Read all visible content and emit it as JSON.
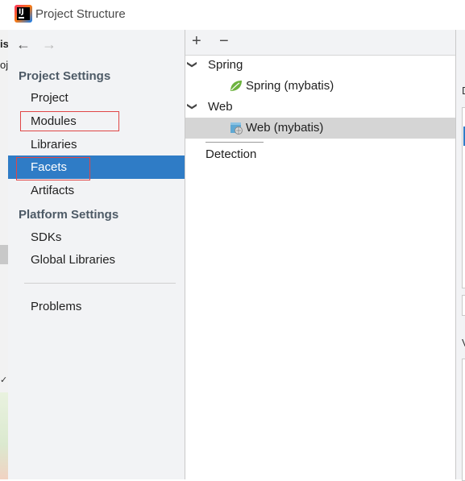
{
  "window": {
    "title": "Project Structure"
  },
  "background_window": {
    "fragments": [
      "is",
      "oj"
    ]
  },
  "sidebar": {
    "project_settings_title": "Project Settings",
    "project_settings_items": [
      {
        "label": "Project",
        "selected": false
      },
      {
        "label": "Modules",
        "selected": false,
        "highlighted": true
      },
      {
        "label": "Libraries",
        "selected": false
      },
      {
        "label": "Facets",
        "selected": true,
        "highlighted": true
      },
      {
        "label": "Artifacts",
        "selected": false
      }
    ],
    "platform_settings_title": "Platform Settings",
    "platform_settings_items": [
      {
        "label": "SDKs"
      },
      {
        "label": "Global Libraries"
      }
    ],
    "problems_label": "Problems"
  },
  "facets_panel": {
    "toolbar": {
      "add": "+",
      "remove": "−"
    },
    "tree": [
      {
        "label": "Spring",
        "children": [
          {
            "label": "Spring (mybatis)",
            "icon": "spring-leaf-icon"
          }
        ]
      },
      {
        "label": "Web",
        "children": [
          {
            "label": "Web (mybatis)",
            "icon": "web-facet-icon",
            "selected": true
          }
        ]
      }
    ],
    "detection_label": "Detection"
  },
  "right_panel": {
    "fragments": [
      "D",
      "V"
    ]
  },
  "colors": {
    "selection": "#2f7cc6",
    "tree_selection": "#d5d5d5",
    "highlight_box": "#e04646",
    "section_title": "#4d5a66",
    "spring_green": "#6db33f"
  }
}
